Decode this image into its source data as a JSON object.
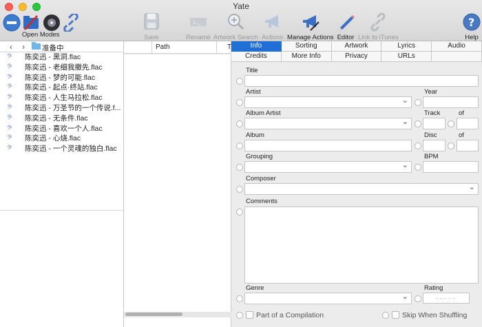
{
  "window": {
    "title": "Yate"
  },
  "toolbar": {
    "open_modes": "Open Modes",
    "save": "Save",
    "rename": "Rename",
    "artwork_search": "Artwork Search",
    "actions": "Actions",
    "manage_actions": "Manage Actions",
    "editor": "Editor",
    "link_itunes": "Link to iTunes",
    "help": "Help"
  },
  "browser": {
    "folder": "准备中",
    "files": [
      "陈奕迅 - 黑洞.flac",
      "陈奕迅 - 老细我撤先.flac",
      "陈奕迅 - 梦的可能.flac",
      "陈奕迅 - 起点·终站.flac",
      "陈奕迅 - 人生马拉松.flac",
      "陈奕迅 - 万圣节的一个传说.f...",
      "陈奕迅 - 无条件.flac",
      "陈奕迅 - 喜欢一个人.flac",
      "陈奕迅 - 心烧.flac",
      "陈奕迅 - 一个灵魂的独白.flac"
    ]
  },
  "columns": {
    "path": "Path",
    "t": "Ti"
  },
  "tabs": {
    "row1": [
      "Info",
      "Sorting",
      "Artwork",
      "Lyrics",
      "Audio"
    ],
    "row2": [
      "Credits",
      "More Info",
      "Privacy",
      "URLs",
      ""
    ],
    "active": "Info"
  },
  "form": {
    "title": "Title",
    "artist": "Artist",
    "year": "Year",
    "album_artist": "Album Artist",
    "track": "Track",
    "of": "of",
    "album": "Album",
    "disc": "Disc",
    "grouping": "Grouping",
    "bpm": "BPM",
    "composer": "Composer",
    "comments": "Comments",
    "genre": "Genre",
    "rating": "Rating",
    "rating_value": "·····",
    "compilation": "Part of a Compilation",
    "skip_shuffle": "Skip When Shuffling"
  }
}
